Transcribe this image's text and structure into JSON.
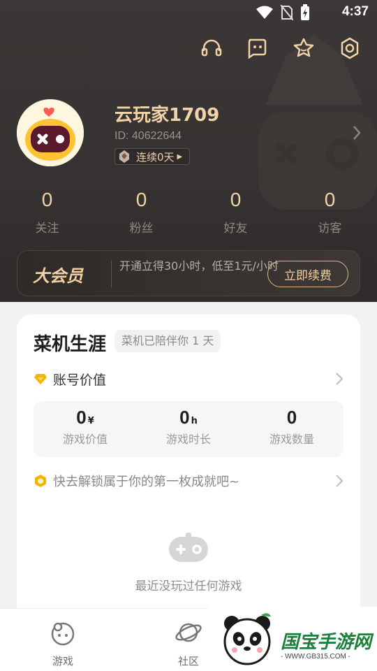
{
  "status": {
    "time": "4:37"
  },
  "profile": {
    "name": "云玩家1709",
    "id_text": "ID: 40622644",
    "streak_label": "连续0天"
  },
  "stats": [
    {
      "value": "0",
      "label": "关注"
    },
    {
      "value": "0",
      "label": "粉丝"
    },
    {
      "value": "0",
      "label": "好友"
    },
    {
      "value": "0",
      "label": "访客"
    }
  ],
  "vip": {
    "logo": "大会员",
    "description": "开通立得30小时，低至1元/小时",
    "button": "立即续费"
  },
  "career": {
    "title": "菜机生涯",
    "tag": "菜机已陪伴你 1 天",
    "account_value_label": "账号价值",
    "metrics": [
      {
        "value": "0",
        "unit": "¥",
        "label": "游戏价值"
      },
      {
        "value": "0",
        "unit": "h",
        "label": "游戏时长"
      },
      {
        "value": "0",
        "unit": "",
        "label": "游戏数量"
      }
    ],
    "achievement_prompt": "快去解锁属于你的第一枚成就吧~",
    "empty_text": "最近没玩过任何游戏"
  },
  "tabs": [
    {
      "label": "游戏",
      "icon": "games-icon"
    },
    {
      "label": "社区",
      "icon": "community-icon"
    }
  ],
  "watermark": {
    "title": "国宝手游网",
    "url": "- WWW.GB315.COM -"
  },
  "colors": {
    "header_bg": "#363231",
    "gold_text": "#f2d3a7",
    "accent_diamond": "#f5b400"
  }
}
